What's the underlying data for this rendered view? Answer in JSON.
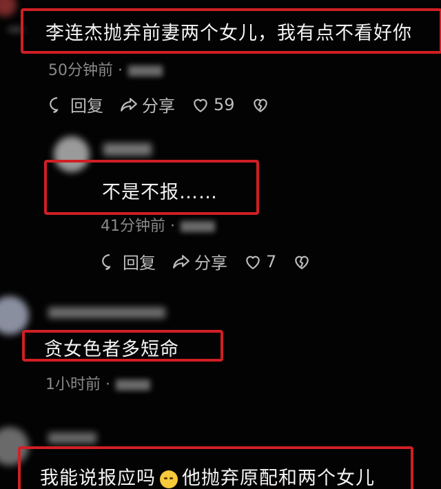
{
  "comments": [
    {
      "text": "李连杰抛弃前妻两个女儿，我有点不看好你",
      "time": "50分钟前 ·",
      "reply_label": "回复",
      "share_label": "分享",
      "likes": "59"
    },
    {
      "text": "不是不报……",
      "time": "41分钟前 ·",
      "reply_label": "回复",
      "share_label": "分享",
      "likes": "7"
    },
    {
      "text": "贪女色者多短命",
      "time": "1小时前 ·"
    },
    {
      "text_before_emoji": "我能说报应吗",
      "text_after_emoji": "他抛弃原配和两个女儿"
    }
  ],
  "colors": {
    "highlight": "#d01f24",
    "background": "#030303",
    "text": "#f4f4f4",
    "meta": "#8a8a8a"
  },
  "icons": [
    "reply-icon",
    "share-icon",
    "heart-icon",
    "broken-heart-icon",
    "emoji-face-icon"
  ]
}
